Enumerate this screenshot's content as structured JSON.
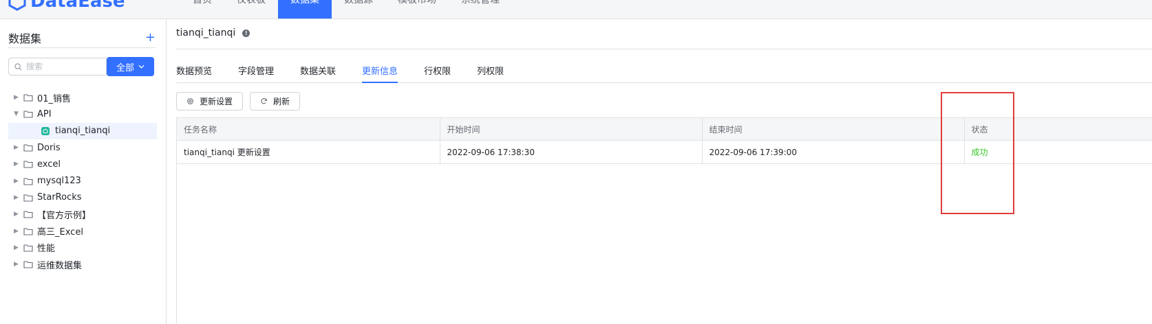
{
  "header": {
    "logo_text": "DataEase",
    "nav": [
      "首页",
      "仪表板",
      "数据集",
      "数据源",
      "模板市场",
      "系统管理"
    ],
    "active_nav": "数据集"
  },
  "sidebar": {
    "title": "数据集",
    "add_label": "+",
    "search": {
      "placeholder": "搜索",
      "value": ""
    },
    "filter_label": "全部",
    "tree": [
      {
        "label": "01_销售",
        "type": "folder",
        "expanded": false
      },
      {
        "label": "API",
        "type": "folder",
        "expanded": true
      },
      {
        "label": "tianqi_tianqi",
        "type": "dataset",
        "selected": true
      },
      {
        "label": "Doris",
        "type": "folder",
        "expanded": false
      },
      {
        "label": "excel",
        "type": "folder",
        "expanded": false
      },
      {
        "label": "mysql123",
        "type": "folder",
        "expanded": false
      },
      {
        "label": "StarRocks",
        "type": "folder",
        "expanded": false
      },
      {
        "label": "【官方示例】",
        "type": "folder",
        "expanded": false
      },
      {
        "label": "高三_Excel",
        "type": "folder",
        "expanded": false
      },
      {
        "label": "性能",
        "type": "folder",
        "expanded": false
      },
      {
        "label": "运维数据集",
        "type": "folder",
        "expanded": false
      }
    ]
  },
  "main": {
    "dataset_title": "tianqi_tianqi",
    "tabs": [
      "数据预览",
      "字段管理",
      "数据关联",
      "更新信息",
      "行权限",
      "列权限"
    ],
    "active_tab": "更新信息",
    "buttons": {
      "update_settings": "更新设置",
      "refresh": "刷新"
    },
    "table": {
      "columns": [
        "任务名称",
        "开始时间",
        "结束时间",
        "状态"
      ],
      "rows": [
        {
          "task": "tianqi_tianqi 更新设置",
          "start": "2022-09-06 17:38:30",
          "end": "2022-09-06 17:39:00",
          "status": "成功"
        }
      ]
    }
  },
  "colors": {
    "accent": "#3370ff",
    "success": "#34c724",
    "highlight": "#e03a3a"
  }
}
